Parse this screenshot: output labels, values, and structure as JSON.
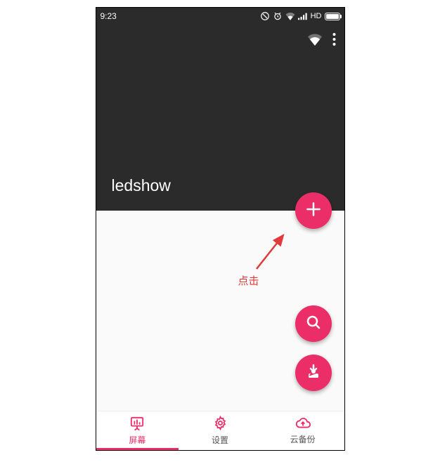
{
  "status": {
    "time": "9:23",
    "hd_label": "HD"
  },
  "appbar": {
    "title": "ledshow"
  },
  "annotation": {
    "label": "点击"
  },
  "nav": {
    "items": [
      {
        "label": "屏幕",
        "active": true
      },
      {
        "label": "设置",
        "active": false
      },
      {
        "label": "云备份",
        "active": false
      }
    ]
  },
  "colors": {
    "accent": "#ec2e68"
  }
}
